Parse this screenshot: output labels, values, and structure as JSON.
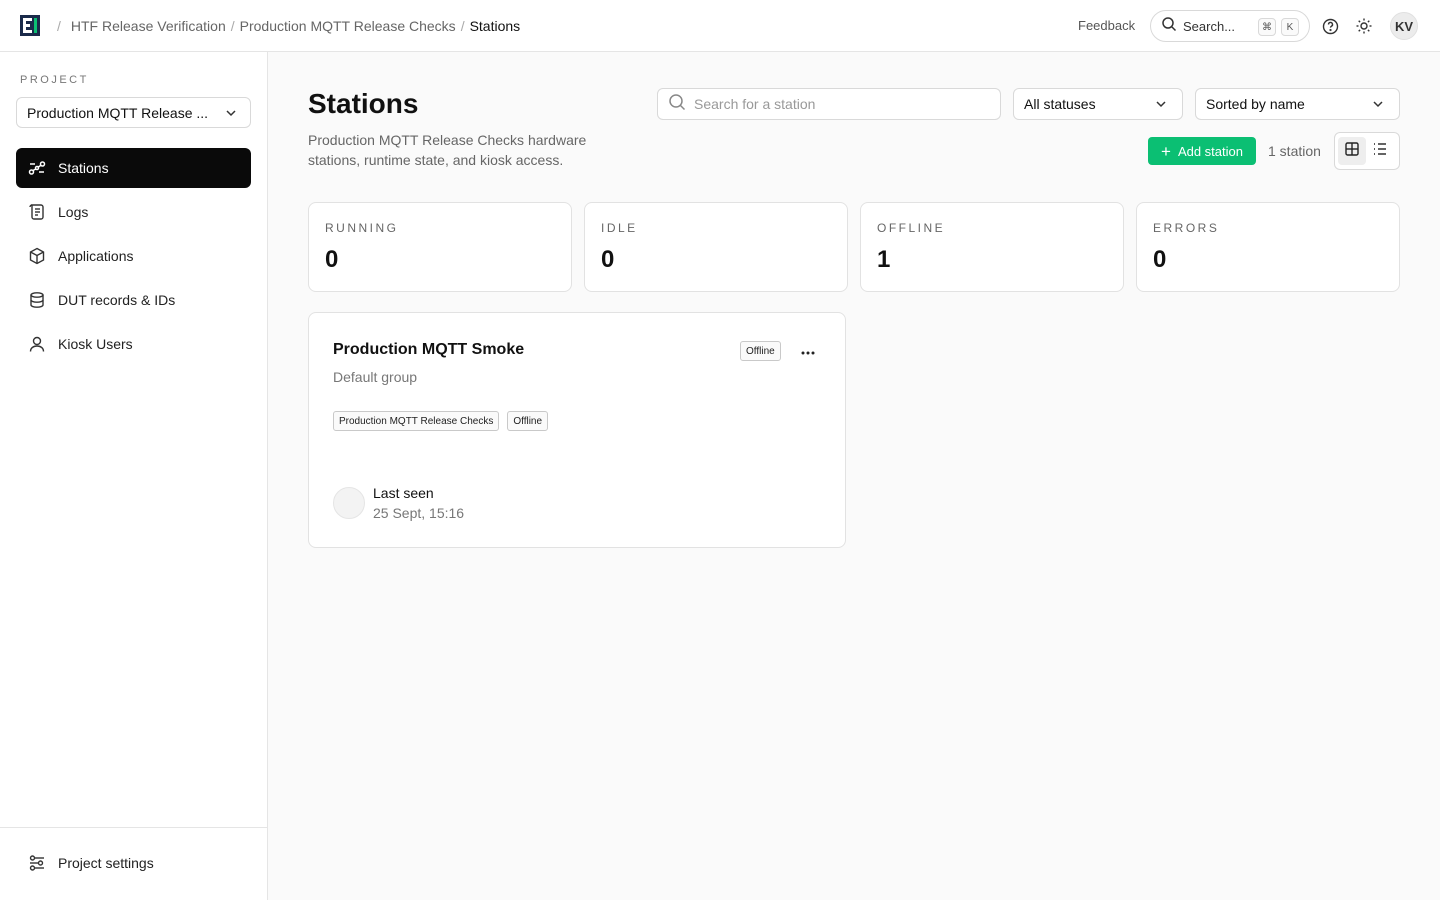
{
  "header": {
    "breadcrumbs": [
      "HTF Release Verification",
      "Production MQTT Release Checks",
      "Stations"
    ],
    "feedback_label": "Feedback",
    "search_label": "Search...",
    "shortcut_keys": [
      "⌘",
      "K"
    ],
    "help_icon": "help-circle-icon",
    "theme_icon": "sun-icon",
    "avatar_initials": "KV"
  },
  "sidebar": {
    "project_label": "PROJECT",
    "project_selected": "Production MQTT Release ...",
    "items": [
      {
        "label": "Stations",
        "icon": "stations-icon",
        "active": true
      },
      {
        "label": "Logs",
        "icon": "logs-icon",
        "active": false
      },
      {
        "label": "Applications",
        "icon": "box-icon",
        "active": false
      },
      {
        "label": "DUT records & IDs",
        "icon": "database-icon",
        "active": false
      },
      {
        "label": "Kiosk Users",
        "icon": "user-icon",
        "active": false
      }
    ],
    "settings_label": "Project settings"
  },
  "main": {
    "title": "Stations",
    "description": "Production MQTT Release Checks hardware stations, runtime state, and kiosk access.",
    "search_placeholder": "Search for a station",
    "status_filter": "All statuses",
    "sort_label": "Sorted by name",
    "add_button": "Add station",
    "station_count": "1 station",
    "stats": [
      {
        "label": "RUNNING",
        "value": "0"
      },
      {
        "label": "IDLE",
        "value": "0"
      },
      {
        "label": "OFFLINE",
        "value": "1"
      },
      {
        "label": "ERRORS",
        "value": "0"
      }
    ],
    "stations": [
      {
        "name": "Production MQTT Smoke",
        "group": "Default group",
        "status": "Offline",
        "tags": [
          "Production MQTT Release Checks",
          "Offline"
        ],
        "last_seen_label": "Last seen",
        "last_seen_value": "25 Sept, 15:16"
      }
    ]
  },
  "colors": {
    "accent_green": "#0bbf73",
    "active_nav": "#0a0a0a",
    "brand_dark": "#1a2a4a",
    "brand_green": "#0bbf73"
  }
}
